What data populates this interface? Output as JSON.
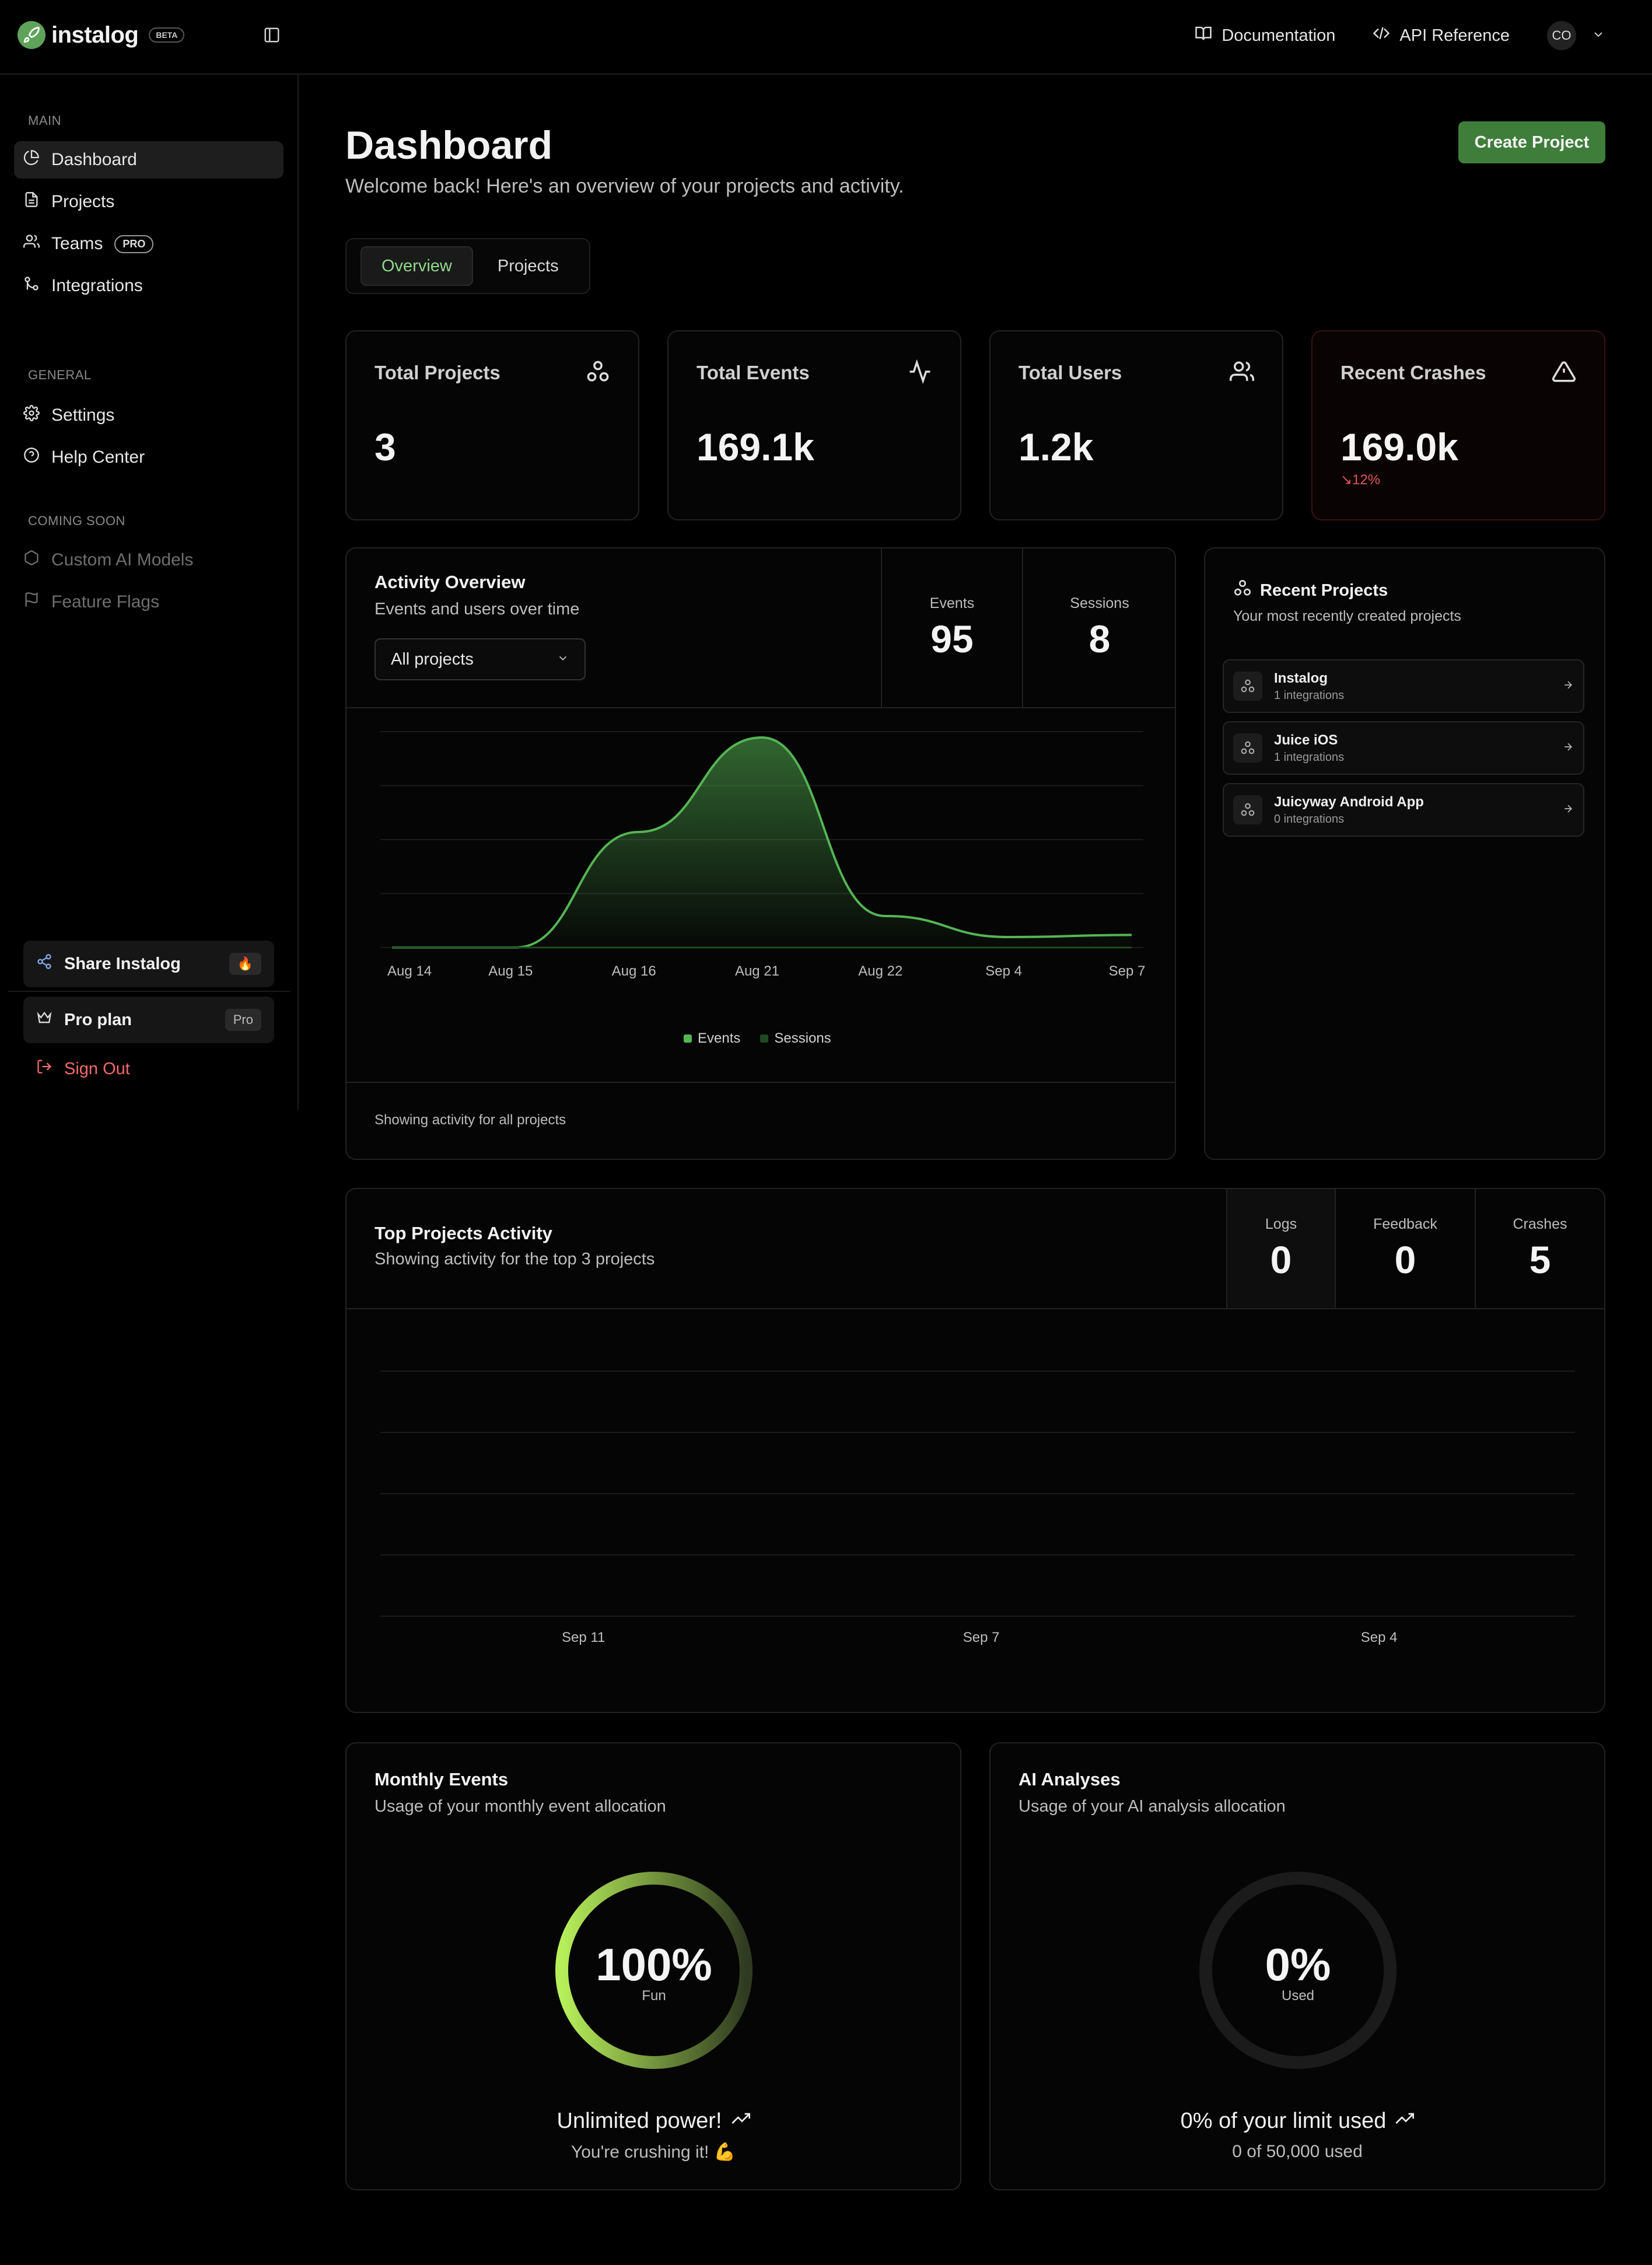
{
  "brand": {
    "name": "instalog",
    "badge": "BETA"
  },
  "topnav": {
    "docs": "Documentation",
    "api": "API Reference",
    "avatar": "CO"
  },
  "sidebar": {
    "main_label": "MAIN",
    "main_items": [
      {
        "label": "Dashboard",
        "icon": "pie-chart-icon"
      },
      {
        "label": "Projects",
        "icon": "document-icon"
      },
      {
        "label": "Teams",
        "icon": "users-icon",
        "badge": "PRO"
      },
      {
        "label": "Integrations",
        "icon": "git-merge-icon"
      }
    ],
    "general_label": "GENERAL",
    "general_items": [
      {
        "label": "Settings",
        "icon": "gear-icon"
      },
      {
        "label": "Help Center",
        "icon": "help-circle-icon"
      }
    ],
    "soon_label": "COMING SOON",
    "soon_items": [
      {
        "label": "Custom AI Models",
        "icon": "box-icon"
      },
      {
        "label": "Feature Flags",
        "icon": "flag-icon"
      }
    ],
    "share": {
      "label": "Share Instalog",
      "badge": "🔥"
    },
    "plan": {
      "label": "Pro plan",
      "badge": "Pro"
    },
    "signout": "Sign Out"
  },
  "page": {
    "title": "Dashboard",
    "subtitle": "Welcome back! Here's an overview of your projects and activity.",
    "create_button": "Create Project",
    "tabs": [
      "Overview",
      "Projects"
    ]
  },
  "stats": [
    {
      "title": "Total Projects",
      "value": "3",
      "icon": "webhook-icon"
    },
    {
      "title": "Total Events",
      "value": "169.1k",
      "icon": "activity-icon"
    },
    {
      "title": "Total Users",
      "value": "1.2k",
      "icon": "users-icon"
    },
    {
      "title": "Recent Crashes",
      "value": "169.0k",
      "delta": "12%",
      "icon": "alert-triangle-icon"
    }
  ],
  "activity": {
    "title": "Activity Overview",
    "subtitle": "Events and users over time",
    "select_value": "All projects",
    "metrics": [
      {
        "label": "Events",
        "value": "95"
      },
      {
        "label": "Sessions",
        "value": "8"
      }
    ],
    "footer": "Showing activity for all projects",
    "legend": [
      "Events",
      "Sessions"
    ]
  },
  "recent_projects": {
    "title": "Recent Projects",
    "subtitle": "Your most recently created projects",
    "items": [
      {
        "name": "Instalog",
        "sub": "1 integrations"
      },
      {
        "name": "Juice iOS",
        "sub": "1 integrations"
      },
      {
        "name": "Juicyway Android App",
        "sub": "0 integrations"
      }
    ]
  },
  "top_projects": {
    "title": "Top Projects Activity",
    "subtitle": "Showing activity for the top 3 projects",
    "metrics": [
      {
        "label": "Logs",
        "value": "0"
      },
      {
        "label": "Feedback",
        "value": "0"
      },
      {
        "label": "Crashes",
        "value": "5"
      }
    ],
    "x_labels": [
      "Sep 11",
      "Sep 7",
      "Sep 4"
    ]
  },
  "monthly": {
    "title": "Monthly Events",
    "subtitle": "Usage of your monthly event allocation",
    "value": "100%",
    "label": "Fun",
    "percent": 100,
    "foot_main": "Unlimited power!",
    "foot_sub": "You're crushing it! 💪"
  },
  "ai": {
    "title": "AI Analyses",
    "subtitle": "Usage of your AI analysis allocation",
    "value": "0%",
    "label": "Used",
    "percent": 0,
    "foot_main": "0% of your limit used",
    "foot_sub": "0 of 50,000 used"
  },
  "colors": {
    "accent": "#5fa35a",
    "button": "#3f7d3a",
    "danger": "#e05555",
    "events": "#55b553",
    "sessions": "#1f4a1f"
  },
  "chart_data": [
    {
      "type": "area",
      "categories": [
        "Aug 14",
        "Aug 15",
        "Aug 16",
        "Aug 21",
        "Aug 22",
        "Sep 4",
        "Sep 7"
      ],
      "series": [
        {
          "name": "Events",
          "values": [
            0,
            0,
            0.55,
            1.0,
            0.15,
            0.05,
            0.06
          ]
        },
        {
          "name": "Sessions",
          "values": [
            0,
            0,
            0,
            0,
            0,
            0,
            0
          ]
        }
      ],
      "grid": true,
      "legend": "bottom"
    },
    {
      "type": "line",
      "categories": [
        "Sep 11",
        "Sep 7",
        "Sep 4"
      ],
      "series": [],
      "grid": true
    }
  ]
}
